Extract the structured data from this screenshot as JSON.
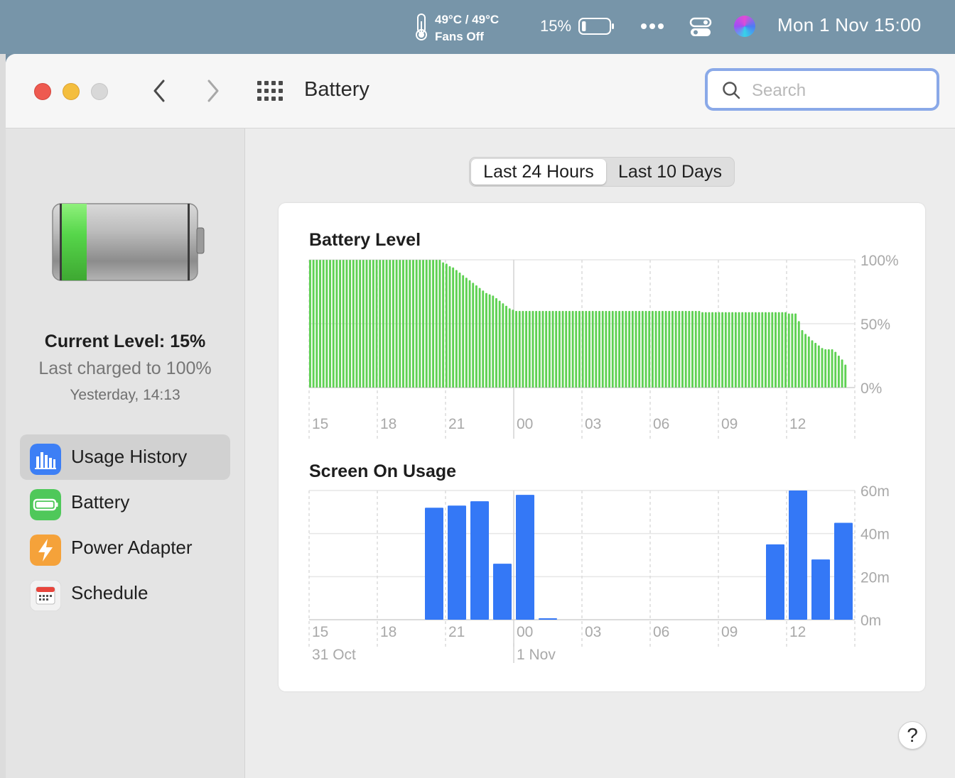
{
  "menubar": {
    "temperature": "49°C / 49°C",
    "fans": "Fans Off",
    "battery_percent": "15%",
    "battery_level": 0.15,
    "clock": "Mon 1 Nov  15:00",
    "icons": [
      "thermometer-icon",
      "battery-icon",
      "more-icon",
      "control-center-icon",
      "siri-icon"
    ]
  },
  "toolbar": {
    "title": "Battery",
    "search_placeholder": "Search",
    "search_value": ""
  },
  "sidebar": {
    "current_level": "Current Level: 15%",
    "last_charged": "Last charged to 100%",
    "charged_time": "Yesterday, 14:13",
    "battery_fill": 0.15,
    "items": [
      {
        "label": "Usage History",
        "icon": "usage-history-icon",
        "selected": true,
        "color": "#3d7ff5"
      },
      {
        "label": "Battery",
        "icon": "battery-pane-icon",
        "selected": false,
        "color": "#4fc85a"
      },
      {
        "label": "Power Adapter",
        "icon": "power-adapter-icon",
        "selected": false,
        "color": "#f5a23a"
      },
      {
        "label": "Schedule",
        "icon": "schedule-icon",
        "selected": false,
        "color": "#f2f2f2"
      }
    ]
  },
  "segments": {
    "options": [
      "Last 24 Hours",
      "Last 10 Days"
    ],
    "selected": "Last 24 Hours"
  },
  "help_label": "?",
  "chart_data": [
    {
      "type": "bar",
      "title": "Battery Level",
      "x_tick_labels": [
        "15",
        "18",
        "21",
        "00",
        "03",
        "06",
        "09",
        "12"
      ],
      "y_tick_labels": [
        "100%",
        "50%",
        "0%"
      ],
      "ylim": [
        0,
        100
      ],
      "color": "#5fd153",
      "grid": true,
      "values": [
        100,
        100,
        100,
        100,
        100,
        100,
        100,
        100,
        100,
        100,
        100,
        100,
        100,
        100,
        100,
        100,
        100,
        100,
        100,
        100,
        100,
        100,
        100,
        100,
        100,
        100,
        100,
        100,
        100,
        100,
        100,
        100,
        100,
        100,
        100,
        100,
        100,
        100,
        100,
        100,
        98,
        97,
        95,
        94,
        92,
        90,
        88,
        86,
        84,
        82,
        80,
        78,
        76,
        74,
        73,
        72,
        70,
        68,
        66,
        64,
        62,
        61,
        60,
        60,
        60,
        60,
        60,
        60,
        60,
        60,
        60,
        60,
        60,
        60,
        60,
        60,
        60,
        60,
        60,
        60,
        60,
        60,
        60,
        60,
        60,
        60,
        60,
        60,
        60,
        60,
        60,
        60,
        60,
        60,
        60,
        60,
        60,
        60,
        60,
        60,
        60,
        60,
        60,
        60,
        60,
        60,
        60,
        60,
        60,
        60,
        60,
        60,
        60,
        60,
        60,
        60,
        60,
        60,
        59,
        59,
        59,
        59,
        59,
        59,
        59,
        59,
        59,
        59,
        59,
        59,
        59,
        59,
        59,
        59,
        59,
        59,
        59,
        59,
        59,
        59,
        59,
        59,
        59,
        59,
        58,
        58,
        58,
        52,
        45,
        42,
        40,
        37,
        35,
        33,
        31,
        30,
        30,
        30,
        28,
        25,
        22,
        18
      ]
    },
    {
      "type": "bar",
      "title": "Screen On Usage",
      "x_tick_labels": [
        "15",
        "18",
        "21",
        "00",
        "03",
        "06",
        "09",
        "12"
      ],
      "date_labels": [
        {
          "label": "31 Oct",
          "hour": 0
        },
        {
          "label": "1 Nov",
          "hour": 9
        }
      ],
      "y_tick_labels": [
        "60m",
        "40m",
        "20m",
        "0m"
      ],
      "ylim": [
        0,
        60
      ],
      "color": "#3478f6",
      "grid": true,
      "hours": [
        "15",
        "16",
        "17",
        "18",
        "19",
        "20",
        "21",
        "22",
        "23",
        "00",
        "01",
        "02",
        "03",
        "04",
        "05",
        "06",
        "07",
        "08",
        "09",
        "10",
        "11",
        "12",
        "13",
        "14"
      ],
      "values": [
        0,
        0,
        0,
        0,
        0,
        52,
        53,
        55,
        26,
        58,
        0.5,
        0,
        0,
        0,
        0,
        0,
        0,
        0,
        0,
        0,
        35,
        60,
        28,
        45
      ]
    }
  ]
}
